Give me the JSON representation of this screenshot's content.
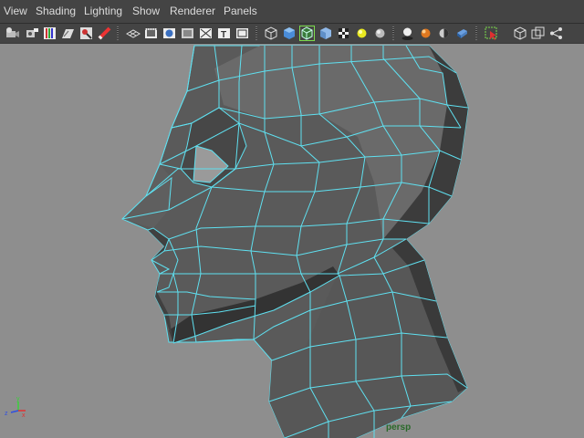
{
  "menubar": {
    "items": [
      "View",
      "Shading",
      "Lighting",
      "Show",
      "Renderer",
      "Panels"
    ]
  },
  "toolbar": {
    "icons": [
      "select-camera-icon",
      "camera-attributes-icon",
      "bookmark-icon",
      "image-plane-icon",
      "2d-pan-zoom-icon",
      "grease-pencil-icon",
      "grid-icon",
      "film-gate-icon",
      "resolution-gate-icon",
      "gate-mask-icon",
      "field-chart-icon",
      "safe-action-icon",
      "wireframe-icon",
      "smooth-shade-icon",
      "wireframe-on-shaded-icon",
      "flat-shade-icon",
      "textured-icon",
      "use-all-lights-icon",
      "default-lighting-icon",
      "shadows-icon",
      "screen-space-ao-icon",
      "depth-of-field-icon",
      "hardware-texturing-icon",
      "isolate-select-icon",
      "xray-icon",
      "xray-active-components-icon",
      "xray-joints-icon"
    ]
  },
  "viewport": {
    "camera_label": "persp",
    "axis": {
      "x": "x",
      "y": "y",
      "z": "z"
    }
  },
  "colors": {
    "menubar_bg": "#444444",
    "viewport_bg": "#8e8e8e",
    "wireframe": "#5fe0f0",
    "mesh_dark": "#3c3c3c",
    "mesh_mid": "#5a5a5a",
    "mesh_light": "#6b6b6b",
    "camera_label": "#2a6a2a"
  }
}
